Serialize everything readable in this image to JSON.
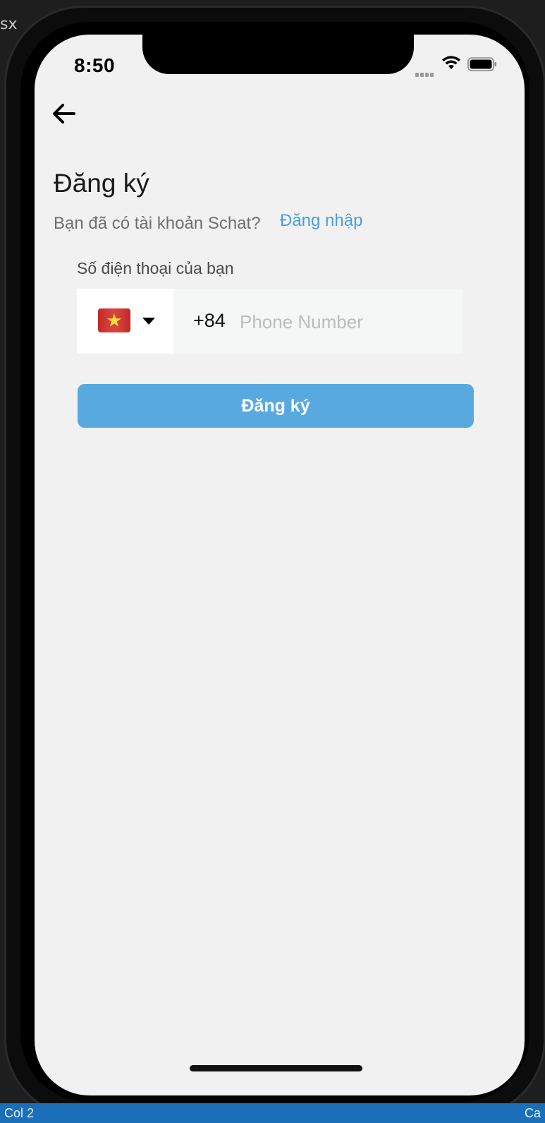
{
  "editor": {
    "tab_fragment": "sx",
    "status_left": "Col 2",
    "status_right": "Ca"
  },
  "status_bar": {
    "time": "8:50",
    "icons": [
      "cellular-signal-icon",
      "wifi-icon",
      "battery-icon"
    ]
  },
  "nav": {
    "back_icon": "arrow-left-icon"
  },
  "signup": {
    "title": "Đăng ký",
    "have_account_text": "Bạn đã có tài khoản Schat?",
    "login_link": "Đăng nhập",
    "phone_label": "Số điện thoại của bạn",
    "country_flag": "vietnam-flag-icon",
    "dial_code": "+84",
    "phone_value": "",
    "phone_placeholder": "Phone Number",
    "submit_label": "Đăng ký"
  },
  "colors": {
    "accent_link": "#4a9fe0",
    "button_bg": "#58a9e0",
    "screen_bg": "#f1f1f1"
  }
}
